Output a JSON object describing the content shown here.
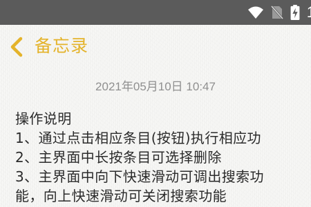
{
  "status_bar": {
    "battery_text": "1",
    "icons": [
      "wifi-icon",
      "no-sim-icon",
      "battery-charging-icon"
    ]
  },
  "header": {
    "back_icon": "chevron-left-icon",
    "title": "备忘录"
  },
  "note": {
    "timestamp": "2021年05月10日 10:47",
    "lines": [
      "操作说明",
      "1、通过点击相应条目(按钮)执行相应功",
      "2、主界面中长按条目可选择删除",
      "3、主界面中向下快速滑动可调出搜索功",
      "能，向上快速滑动可关闭搜索功能"
    ]
  },
  "colors": {
    "status_bar": "#5b5b5b",
    "accent": "#e4b32a",
    "timestamp": "#8f8f8f",
    "text": "#2b2b2b",
    "paper": "#f4f4f2"
  }
}
